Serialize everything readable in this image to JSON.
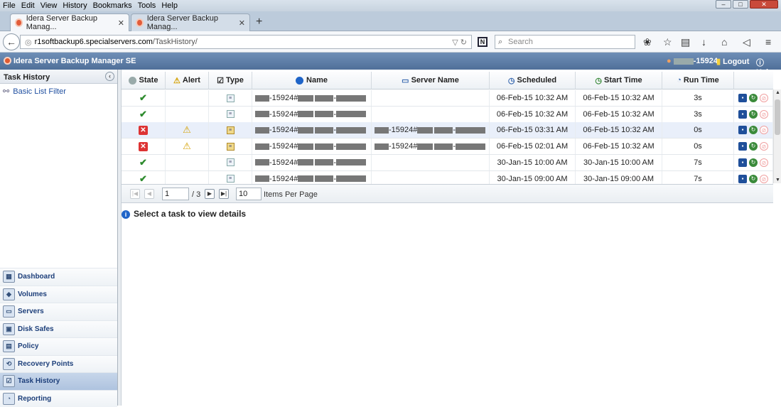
{
  "browser": {
    "menu": [
      "File",
      "Edit",
      "View",
      "History",
      "Bookmarks",
      "Tools",
      "Help"
    ],
    "tabs": [
      {
        "label": "Idera Server Backup Manag...",
        "active": true
      },
      {
        "label": "Idera Server Backup Manag...",
        "active": false
      }
    ],
    "url_host": "r1softbackup6.specialservers.com",
    "url_path": "/TaskHistory/",
    "search_placeholder": "Search"
  },
  "app": {
    "title": "Idera Server Backup Manager SE",
    "user": "-15924",
    "logout": "Logout",
    "help": "Help"
  },
  "sidebar": {
    "panel_title": "Task History",
    "filter_label": "Basic List Filter",
    "nav": [
      {
        "label": "Dashboard",
        "icon": "dashboard-icon"
      },
      {
        "label": "Volumes",
        "icon": "volumes-icon"
      },
      {
        "label": "Servers",
        "icon": "servers-icon"
      },
      {
        "label": "Disk Safes",
        "icon": "disk-safe-icon"
      },
      {
        "label": "Policy",
        "icon": "policy-icon"
      },
      {
        "label": "Recovery Points",
        "icon": "recovery-points-icon"
      },
      {
        "label": "Task History",
        "icon": "task-history-icon",
        "active": true
      },
      {
        "label": "Reporting",
        "icon": "reporting-icon"
      }
    ]
  },
  "grid": {
    "columns": [
      "State",
      "Alert",
      "Type",
      "Name",
      "Server Name",
      "Scheduled",
      "Start Time",
      "Run Time"
    ],
    "rows": [
      {
        "state": "ok",
        "alert": "",
        "type": "task",
        "name_suffix": "-15924#",
        "server": "",
        "scheduled": "06-Feb-15 10:32 AM",
        "start": "06-Feb-15 10:32 AM",
        "run": "3s"
      },
      {
        "state": "ok",
        "alert": "",
        "type": "task",
        "name_suffix": "-15924#",
        "server": "",
        "scheduled": "06-Feb-15 10:32 AM",
        "start": "06-Feb-15 10:32 AM",
        "run": "3s"
      },
      {
        "state": "fail",
        "alert": "warn",
        "type": "policy",
        "name_suffix": "-15924#",
        "server": "-15924#",
        "scheduled": "06-Feb-15 03:31 AM",
        "start": "06-Feb-15 10:32 AM",
        "run": "0s",
        "selected": true
      },
      {
        "state": "fail",
        "alert": "warn",
        "type": "policy",
        "name_suffix": "-15924#",
        "server": "-15924#",
        "scheduled": "06-Feb-15 02:01 AM",
        "start": "06-Feb-15 10:32 AM",
        "run": "0s"
      },
      {
        "state": "ok",
        "alert": "",
        "type": "task",
        "name_suffix": "-15924#",
        "server": "",
        "scheduled": "30-Jan-15 10:00 AM",
        "start": "30-Jan-15 10:00 AM",
        "run": "7s"
      },
      {
        "state": "ok",
        "alert": "",
        "type": "task",
        "name_suffix": "-15924#",
        "server": "",
        "scheduled": "30-Jan-15 09:00 AM",
        "start": "30-Jan-15 09:00 AM",
        "run": "7s"
      }
    ]
  },
  "pager": {
    "page": "1",
    "of_label": "/ 3",
    "per_page": "10",
    "per_page_label": "Items Per Page"
  },
  "details": {
    "message": "Select a task to view details"
  }
}
